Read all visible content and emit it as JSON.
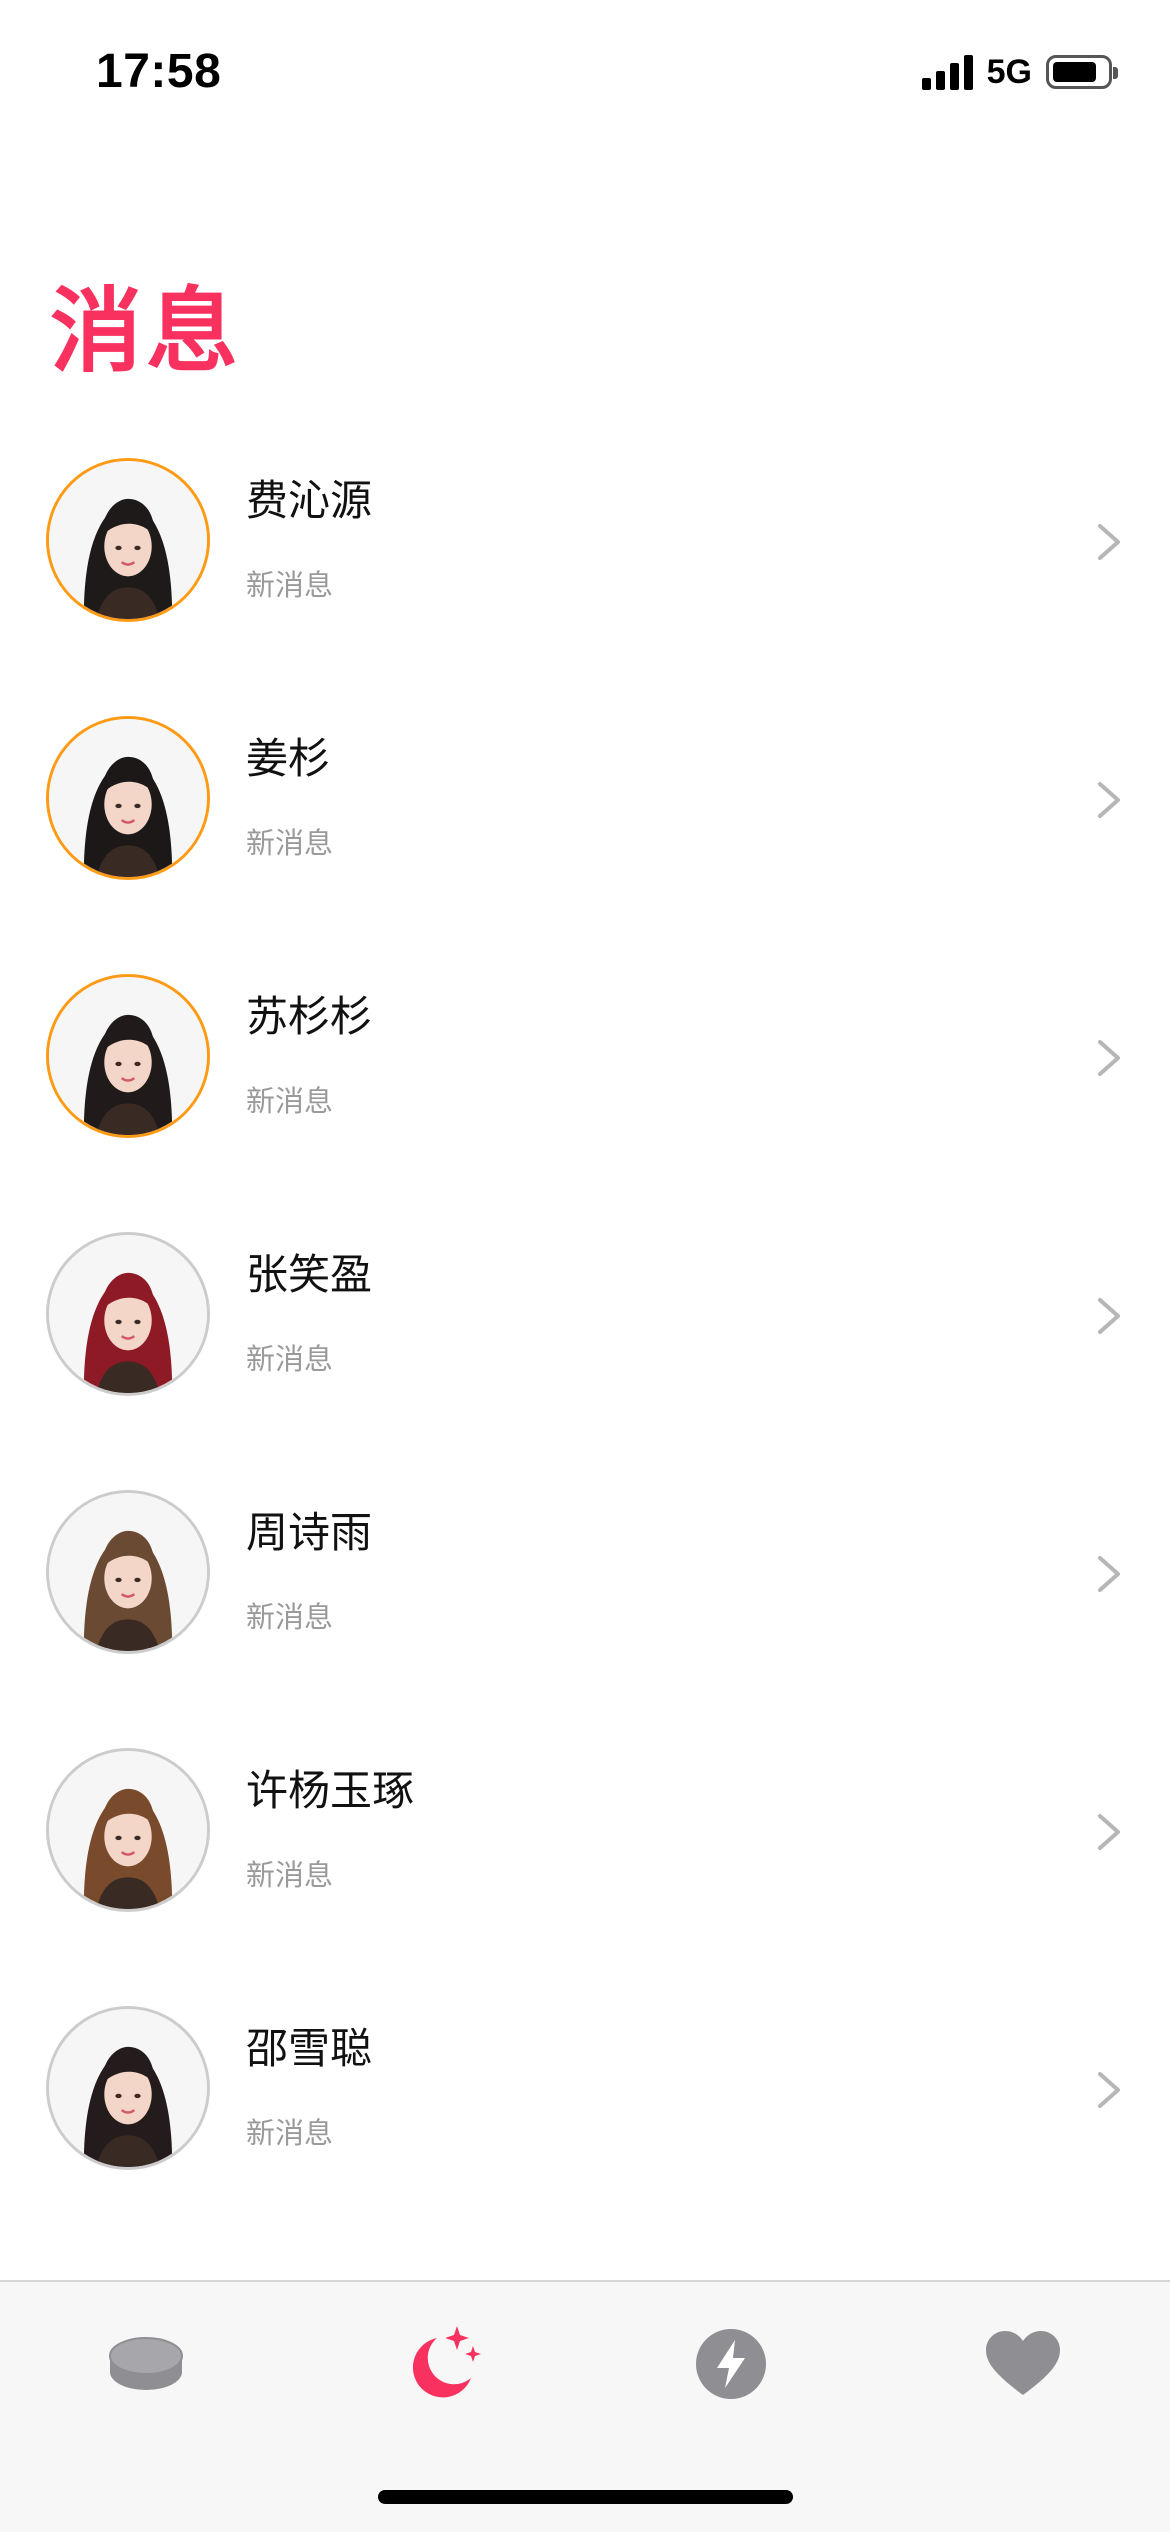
{
  "status_bar": {
    "time": "17:58",
    "network": "5G",
    "battery_level": 0.82
  },
  "page": {
    "title": "消息"
  },
  "messages": [
    {
      "name": "费沁源",
      "subtitle": "新消息",
      "unread": true,
      "avatar_hair_color": "#1e1a1a"
    },
    {
      "name": "姜杉",
      "subtitle": "新消息",
      "unread": true,
      "avatar_hair_color": "#1c1818"
    },
    {
      "name": "苏杉杉",
      "subtitle": "新消息",
      "unread": true,
      "avatar_hair_color": "#201a1a"
    },
    {
      "name": "张笑盈",
      "subtitle": "新消息",
      "unread": false,
      "avatar_hair_color": "#8e1a26"
    },
    {
      "name": "周诗雨",
      "subtitle": "新消息",
      "unread": false,
      "avatar_hair_color": "#6b4a34"
    },
    {
      "name": "许杨玉琢",
      "subtitle": "新消息",
      "unread": false,
      "avatar_hair_color": "#7a4a2c"
    },
    {
      "name": "邵雪聪",
      "subtitle": "新消息",
      "unread": false,
      "avatar_hair_color": "#241c1c"
    }
  ],
  "tab_bar": {
    "active_index": 1,
    "tabs": [
      {
        "icon": "coin-stack-icon"
      },
      {
        "icon": "moon-stars-icon"
      },
      {
        "icon": "lightning-icon"
      },
      {
        "icon": "heart-icon"
      }
    ]
  },
  "colors": {
    "accent": "#f8315f",
    "unread_ring": "#ff9a15",
    "read_ring": "#cccccc",
    "inactive_icon": "#8e8e93",
    "subtitle": "#9a9a9a"
  }
}
